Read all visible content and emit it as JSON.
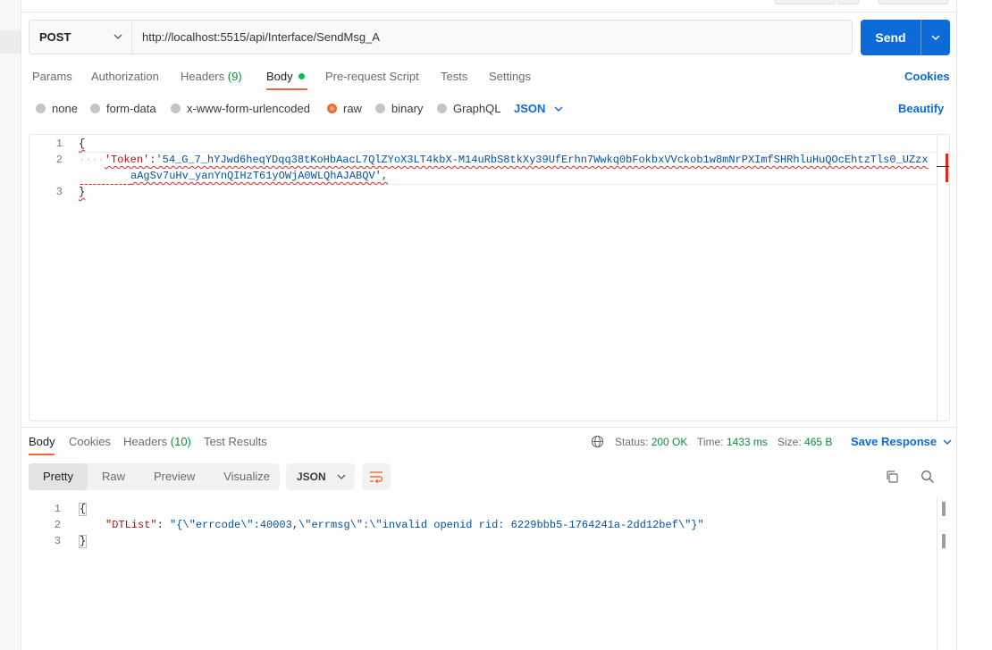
{
  "request": {
    "method": "POST",
    "url": "http://localhost:5515/api/Interface/SendMsg_A",
    "send_label": "Send"
  },
  "request_tabs": {
    "params": "Params",
    "authorization": "Authorization",
    "headers": "Headers",
    "headers_count": "(9)",
    "body": "Body",
    "pre_request": "Pre-request Script",
    "tests": "Tests",
    "settings": "Settings",
    "cookies": "Cookies"
  },
  "body_types": {
    "none": "none",
    "form_data": "form-data",
    "urlencoded": "x-www-form-urlencoded",
    "raw": "raw",
    "binary": "binary",
    "graphql": "GraphQL",
    "language": "JSON",
    "beautify": "Beautify",
    "selected": "raw"
  },
  "request_body": {
    "line_numbers": [
      "1",
      "2",
      "3"
    ],
    "open_brace": "{",
    "indent_dots": "····",
    "token_key": "'Token'",
    "colon": ":",
    "token_value_1": "'54_G_7_hYJwd6heqYDqq38tKoHbAacL7QlZYoX3LT4kbX-M14uRbS8tkXy39UfErhn7Wwkq0bFokbxVVckob1w8mNrPXImfSHRhluHuQOcEhtzTls0_UZzx",
    "token_value_2": "aAgSv7uHv_yanYnQIHzT61yOWjA0WLQhAJABQV',",
    "close_brace": "}"
  },
  "response_tabs": {
    "body": "Body",
    "cookies": "Cookies",
    "headers": "Headers",
    "headers_count": "(10)",
    "test_results": "Test Results"
  },
  "response_meta": {
    "status_label": "Status:",
    "status_value": "200 OK",
    "time_label": "Time:",
    "time_value": "1433 ms",
    "size_label": "Size:",
    "size_value": "465 B",
    "save_response": "Save Response"
  },
  "response_views": {
    "pretty": "Pretty",
    "raw": "Raw",
    "preview": "Preview",
    "visualize": "Visualize",
    "format": "JSON"
  },
  "response_body": {
    "line_numbers": [
      "1",
      "2",
      "3"
    ],
    "open_brace": "{",
    "key": "\"DTList\"",
    "colon": ":",
    "value": "\"{\\\"errcode\\\":40003,\\\"errmsg\\\":\\\"invalid openid rid: 6229bbb5-1764241a-2dd12bef\\\"}\"",
    "close_brace": "}"
  },
  "colors": {
    "accent_blue": "#0c6bd8",
    "tab_underline": "#e96d3b",
    "status_green": "#0a8f3c",
    "error_red": "#e02424"
  }
}
